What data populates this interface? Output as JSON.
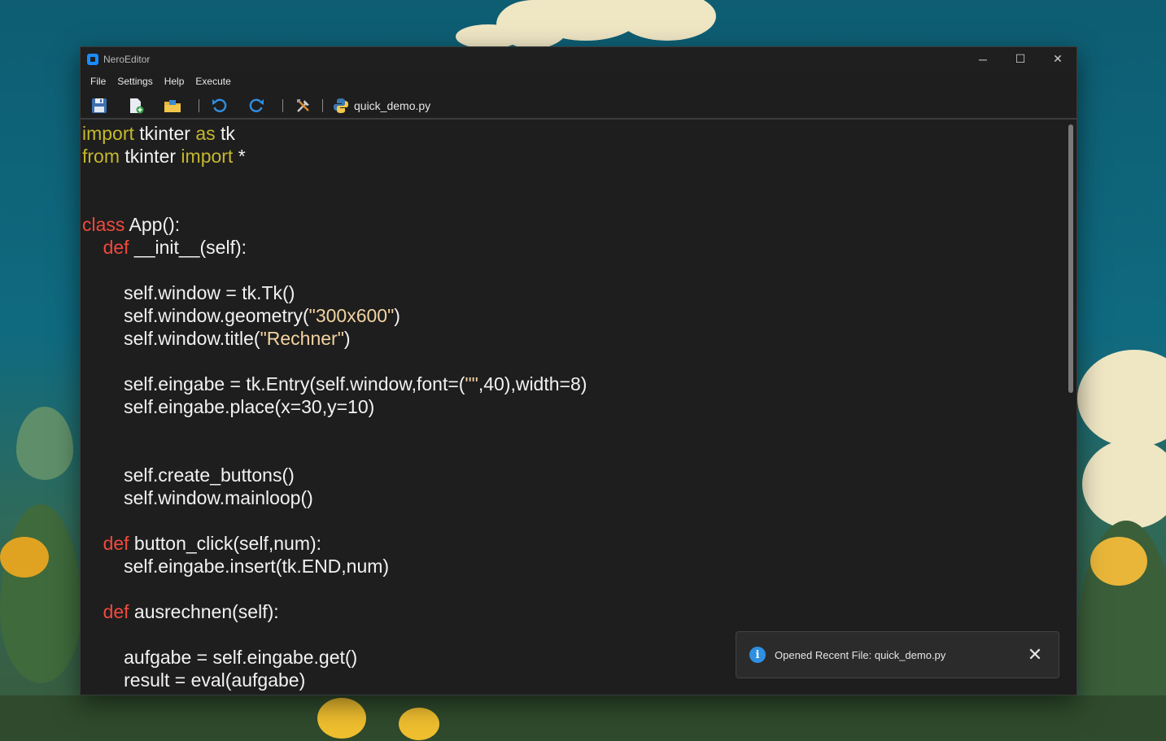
{
  "window": {
    "title": "NeroEditor",
    "controls": {
      "minimize": "─",
      "maximize": "☐",
      "close": "✕"
    }
  },
  "menu": [
    "File",
    "Settings",
    "Help",
    "Execute"
  ],
  "toolbar": {
    "icons": [
      "save-icon",
      "new-file-icon",
      "open-folder-icon",
      "undo-icon",
      "redo-icon",
      "build-tools-icon",
      "python-icon"
    ],
    "current_file": "quick_demo.py"
  },
  "colors": {
    "keyword_yellow": "#c4b82e",
    "keyword_red": "#f04a3c",
    "string": "#f2d3a0",
    "text": "#f2f2f2",
    "background": "#1e1e1e",
    "accent": "#1a8cff"
  },
  "code_lines": [
    [
      [
        "import",
        "kw-y"
      ],
      [
        " tkinter ",
        ""
      ],
      [
        "as",
        "kw-y"
      ],
      [
        " tk",
        ""
      ]
    ],
    [
      [
        "from",
        "kw-y"
      ],
      [
        " tkinter ",
        ""
      ],
      [
        "import",
        "kw-y"
      ],
      [
        " *",
        ""
      ]
    ],
    [],
    [],
    [
      [
        "class",
        "kw-r"
      ],
      [
        " App():",
        ""
      ]
    ],
    [
      [
        "    ",
        ""
      ],
      [
        "def",
        "kw-r"
      ],
      [
        " __init__(self):",
        ""
      ]
    ],
    [],
    [
      [
        "        self.window = tk.Tk()",
        ""
      ]
    ],
    [
      [
        "        self.window.geometry(",
        ""
      ],
      [
        "\"300x600\"",
        "str"
      ],
      [
        ")",
        ""
      ]
    ],
    [
      [
        "        self.window.title(",
        ""
      ],
      [
        "\"Rechner\"",
        "str"
      ],
      [
        ")",
        ""
      ]
    ],
    [],
    [
      [
        "        self.eingabe = tk.Entry(self.window,font=(",
        ""
      ],
      [
        "\"\"",
        "str"
      ],
      [
        ",40),width=8)",
        ""
      ]
    ],
    [
      [
        "        self.eingabe.place(x=30,y=10)",
        ""
      ]
    ],
    [],
    [],
    [
      [
        "        self.create_buttons()",
        ""
      ]
    ],
    [
      [
        "        self.window.mainloop()",
        ""
      ]
    ],
    [],
    [
      [
        "    ",
        ""
      ],
      [
        "def",
        "kw-r"
      ],
      [
        " button_click(self,num):",
        ""
      ]
    ],
    [
      [
        "        self.eingabe.insert(tk.END,num)",
        ""
      ]
    ],
    [],
    [
      [
        "    ",
        ""
      ],
      [
        "def",
        "kw-r"
      ],
      [
        " ausrechnen(self):",
        ""
      ]
    ],
    [],
    [
      [
        "        aufgabe = self.eingabe.get()",
        ""
      ]
    ],
    [
      [
        "        result = eval(aufgabe)",
        ""
      ]
    ]
  ],
  "notification": {
    "icon": "info-icon",
    "message": "Opened Recent File: quick_demo.py",
    "close": "✕"
  }
}
